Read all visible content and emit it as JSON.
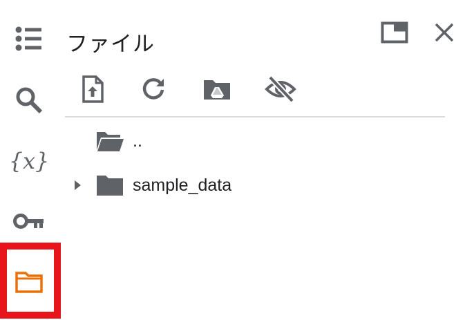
{
  "panel": {
    "title": "ファイル"
  },
  "rail": {
    "items": [
      {
        "name": "table-of-contents-icon"
      },
      {
        "name": "search-icon"
      },
      {
        "name": "variables-icon"
      },
      {
        "name": "secrets-key-icon"
      },
      {
        "name": "files-folder-icon",
        "active": true,
        "accent": "#e8710a"
      }
    ]
  },
  "header_actions": [
    {
      "name": "move-to-tab-icon"
    },
    {
      "name": "close-icon"
    }
  ],
  "toolbar": [
    {
      "name": "upload-icon"
    },
    {
      "name": "refresh-icon"
    },
    {
      "name": "mount-drive-icon"
    },
    {
      "name": "hide-files-icon"
    }
  ],
  "tree": {
    "items": [
      {
        "label": "..",
        "icon": "folder-open-icon",
        "expandable": false
      },
      {
        "label": "sample_data",
        "icon": "folder-icon",
        "expandable": true
      }
    ]
  },
  "colors": {
    "icon": "#5f6368",
    "highlight": "#e8141b",
    "active": "#e8710a"
  }
}
